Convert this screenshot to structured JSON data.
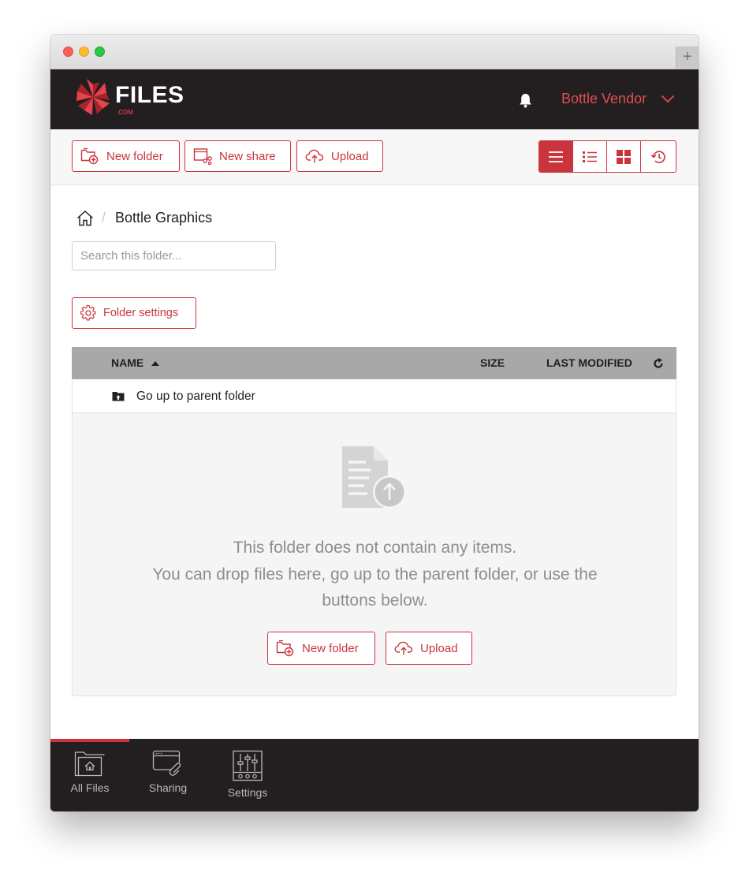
{
  "colors": {
    "accent": "#c9343d",
    "topbar": "#231f20",
    "user_text": "#e04c54"
  },
  "brand": {
    "name": "FILES",
    "suffix": ".COM"
  },
  "header": {
    "user_name": "Bottle Vendor",
    "notifications_icon": "bell-icon"
  },
  "toolbar": {
    "new_folder_label": "New folder",
    "new_share_label": "New share",
    "upload_label": "Upload",
    "view_modes": [
      "list-view",
      "detail-view",
      "grid-view",
      "history-view"
    ],
    "active_view": "list-view"
  },
  "breadcrumb": {
    "current": "Bottle Graphics",
    "separator": "/"
  },
  "search": {
    "placeholder": "Search this folder..."
  },
  "folder_settings_label": "Folder settings",
  "table": {
    "col_name": "NAME",
    "col_size": "SIZE",
    "col_modified": "LAST MODIFIED",
    "sort_column": "NAME",
    "sort_direction": "ascending",
    "parent_row_label": "Go up to parent folder"
  },
  "empty_state": {
    "line1": "This folder does not contain any items.",
    "line2": "You can drop files here, go up to the parent folder, or use the",
    "line3": "buttons below.",
    "new_folder_label": "New folder",
    "upload_label": "Upload"
  },
  "bottom_nav": {
    "items": [
      {
        "label": "All Files",
        "icon": "home-folder-icon",
        "active": true
      },
      {
        "label": "Sharing",
        "icon": "share-window-icon",
        "active": false
      },
      {
        "label": "Settings",
        "icon": "sliders-icon",
        "active": false
      }
    ]
  }
}
